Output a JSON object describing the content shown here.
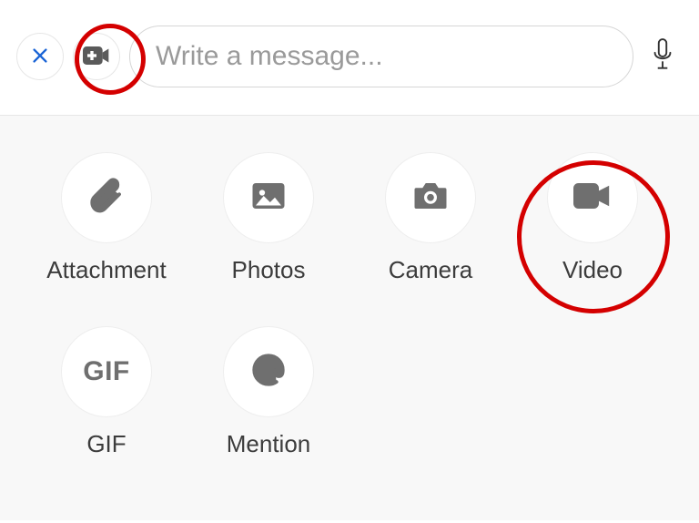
{
  "compose": {
    "placeholder": "Write a message..."
  },
  "attachments": {
    "attachment": "Attachment",
    "photos": "Photos",
    "camera": "Camera",
    "video": "Video",
    "gif": "GIF",
    "gif_icon_text": "GIF",
    "mention": "Mention"
  }
}
